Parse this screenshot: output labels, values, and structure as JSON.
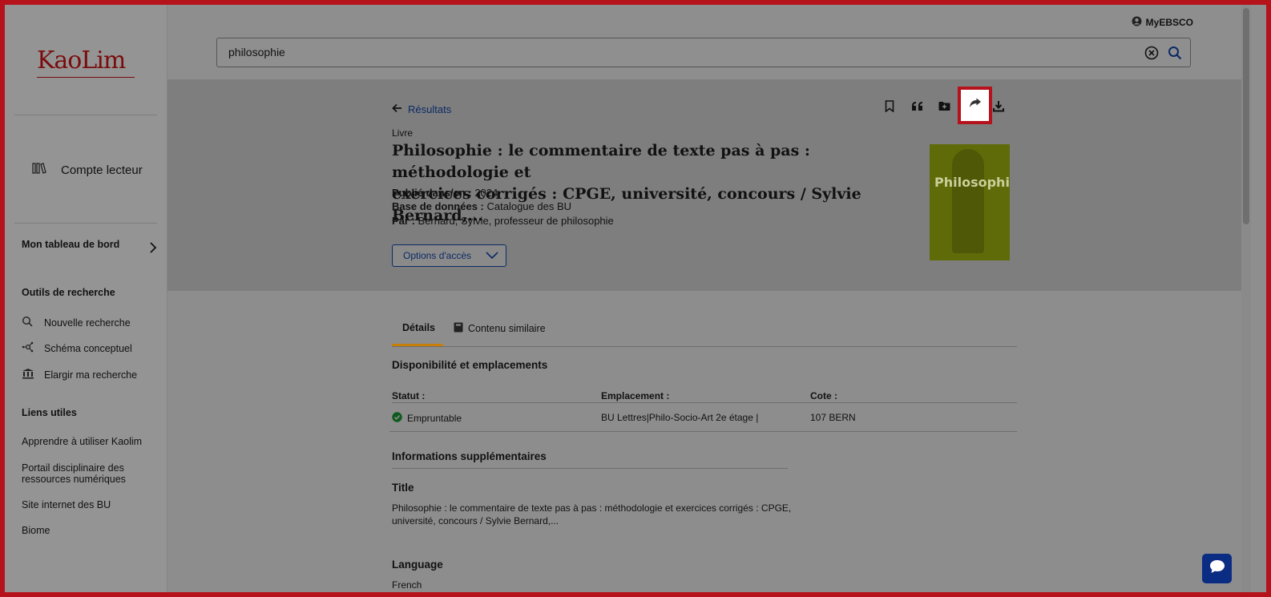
{
  "sidebar": {
    "logo": "KaoLim",
    "account_label": "Compte lecteur",
    "dashboard_label": "Mon tableau de bord",
    "research_tools_heading": "Outils de recherche",
    "research_tools": [
      {
        "label": "Nouvelle recherche",
        "icon": "search-icon"
      },
      {
        "label": "Schéma conceptuel",
        "icon": "concept-map-icon"
      },
      {
        "label": "Elargir ma recherche",
        "icon": "institution-icon"
      }
    ],
    "useful_links_heading": "Liens utiles",
    "useful_links": [
      "Apprendre à utiliser Kaolim",
      "Portail disciplinaire des",
      "ressources numériques",
      "Site internet des BU",
      "Biome"
    ]
  },
  "header": {
    "myebsco_label": "MyEBSCO",
    "search_value": "philosophie"
  },
  "record": {
    "back_label": "Résultats",
    "type": "Livre",
    "title_line1": "Philosophie : le commentaire de texte pas à pas : méthodologie et",
    "title_line2": "exercices corrigés : CPGE, université, concours / Sylvie Bernard,...",
    "published_label": "Publié dans/en :",
    "published_value": "2024",
    "database_label": "Base de données :",
    "database_value": "Catalogue des BU",
    "author_label": "Par :",
    "author_value": "Bernard, Sylvie, professeur de philosophie",
    "access_button_label": "Options d'accès",
    "cover_title": "Philosophie",
    "toolbar": [
      "bookmark-icon",
      "quote-icon",
      "folder-icon",
      "share-icon",
      "download-icon"
    ]
  },
  "tabs": [
    {
      "label": "Détails",
      "active": true
    },
    {
      "label": "Contenu similaire",
      "active": false
    }
  ],
  "availability": {
    "heading": "Disponibilité et emplacements",
    "columns": [
      "Statut :",
      "Emplacement :",
      "Cote :"
    ],
    "row": {
      "status": "Empruntable",
      "location": "BU Lettres|Philo-Socio-Art 2e étage |",
      "call_number": "107 BERN"
    }
  },
  "additional": {
    "heading": "Informations supplémentaires",
    "title_label": "Title",
    "title_line1": "Philosophie : le commentaire de texte pas à pas : méthodologie et exercices corrigés : CPGE,",
    "title_line2": "université, concours / Sylvie Bernard,...",
    "language_label": "Language",
    "language_value": "French"
  },
  "colors": {
    "highlight": "#b5121b",
    "link": "#0b2a66",
    "tab_accent": "#c77f0a",
    "chat": "#0a2c82"
  }
}
